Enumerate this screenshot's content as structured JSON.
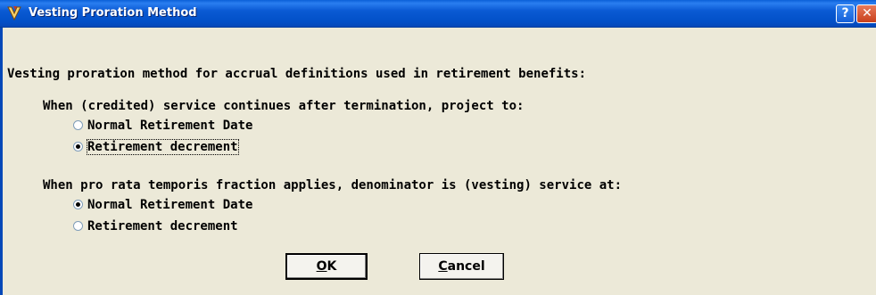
{
  "window": {
    "title": "Vesting Proration Method",
    "help_glyph": "?",
    "close_glyph": "✕"
  },
  "heading": "Vesting proration method for accrual definitions used in retirement benefits:",
  "group1": {
    "label": "When (credited) service continues after termination, project to:",
    "options": [
      {
        "label": "Normal Retirement Date",
        "selected": false
      },
      {
        "label": "Retirement decrement",
        "selected": true,
        "focused": true
      }
    ]
  },
  "group2": {
    "label": "When pro rata temporis fraction applies, denominator is (vesting) service at:",
    "options": [
      {
        "label": "Normal Retirement Date",
        "selected": true
      },
      {
        "label": "Retirement decrement",
        "selected": false
      }
    ]
  },
  "buttons": {
    "ok": {
      "mnemonic": "O",
      "rest": "K"
    },
    "cancel": {
      "mnemonic": "C",
      "rest": "ancel"
    }
  },
  "colors": {
    "titlebar": "#0a5ad4",
    "dialog_bg": "#ece9d8",
    "text": "#000000"
  },
  "icons": {
    "app": "app-logo-icon",
    "help": "help-icon",
    "close": "close-icon"
  }
}
